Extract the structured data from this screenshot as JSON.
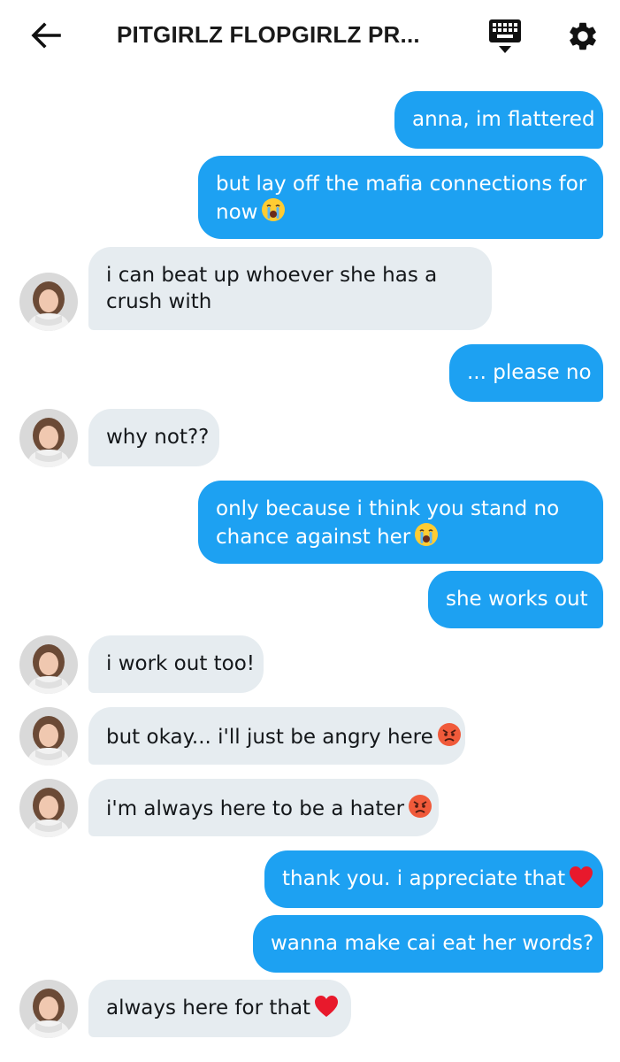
{
  "header": {
    "title": "PITGIRLZ FLOPGIRLZ PR...",
    "back_icon": "arrow-left-icon",
    "keyboard_icon": "keyboard-icon",
    "settings_icon": "gear-icon"
  },
  "colors": {
    "sent_bubble": "#1da1f2",
    "received_bubble": "#e6ecf0",
    "sent_text": "#ffffff",
    "received_text": "#14171a"
  },
  "messages": [
    {
      "direction": "sent",
      "lines": [
        "anna, im flattered"
      ]
    },
    {
      "direction": "sent",
      "lines": [
        "but lay off the mafia connections for",
        "now"
      ],
      "emoji": "loudly-crying-face"
    },
    {
      "direction": "received",
      "lines": [
        "i can beat up whoever she has a",
        "crush with"
      ]
    },
    {
      "direction": "sent",
      "lines": [
        "... please no"
      ]
    },
    {
      "direction": "received",
      "lines": [
        "why not??"
      ]
    },
    {
      "direction": "sent",
      "lines": [
        "only because i think you stand no",
        "chance against her"
      ],
      "emoji": "loudly-crying-face"
    },
    {
      "direction": "sent",
      "lines": [
        "she works out"
      ]
    },
    {
      "direction": "received",
      "lines": [
        "i work out too!"
      ]
    },
    {
      "direction": "received",
      "lines": [
        "but okay... i'll just be angry here"
      ],
      "emoji": "angry-face"
    },
    {
      "direction": "received",
      "lines": [
        "i'm always here to be a hater"
      ],
      "emoji": "angry-face"
    },
    {
      "direction": "sent",
      "lines": [
        "thank you. i appreciate that"
      ],
      "emoji": "red-heart"
    },
    {
      "direction": "sent",
      "lines": [
        "wanna make cai eat her words?"
      ]
    },
    {
      "direction": "received",
      "lines": [
        "always here for that"
      ],
      "emoji": "red-heart"
    }
  ]
}
